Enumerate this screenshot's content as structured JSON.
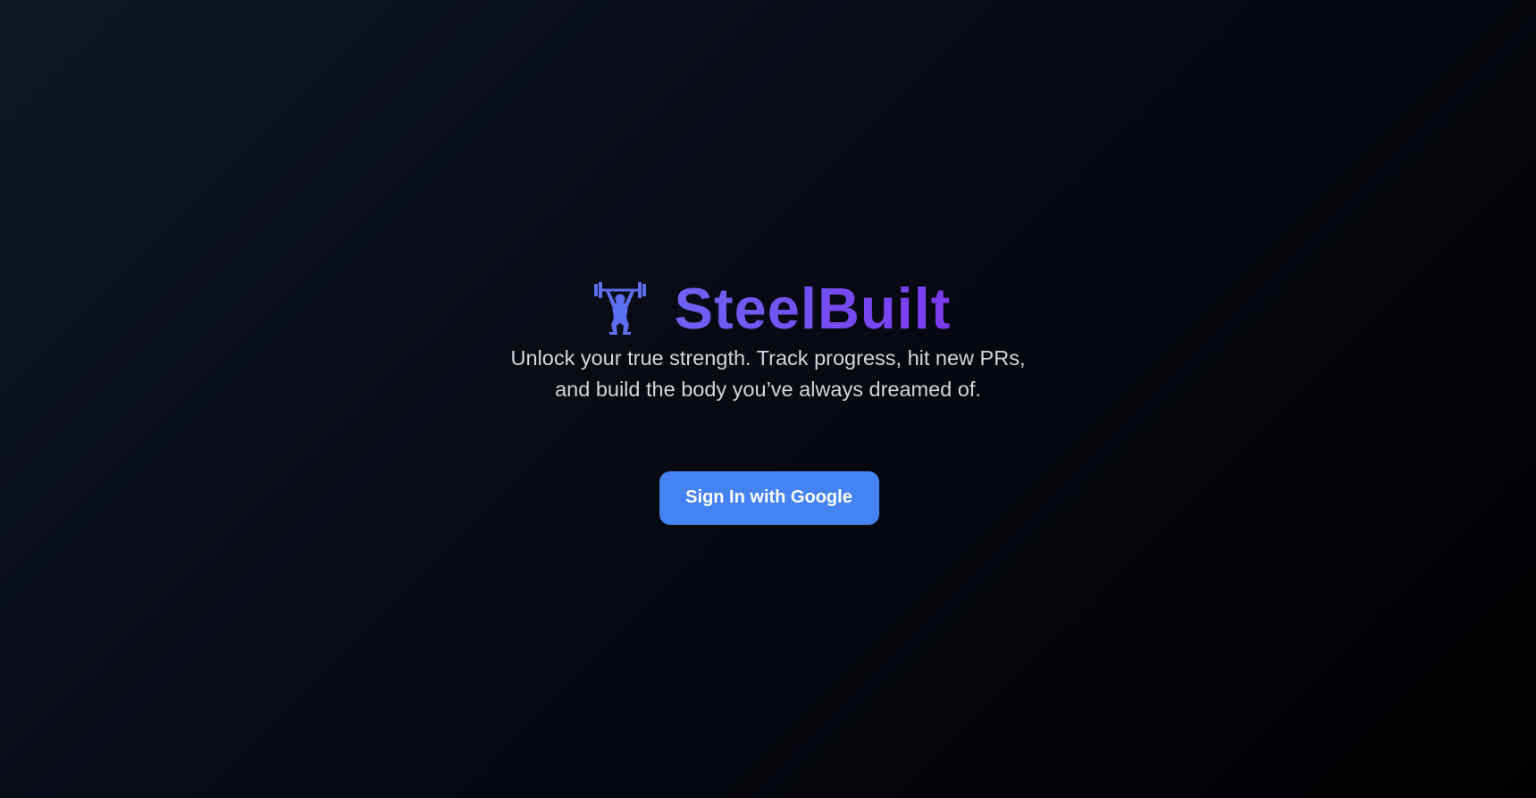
{
  "brand": {
    "icon": "weightlifter-icon",
    "name": "SteelBuilt",
    "gradient_colors": [
      "#6d63f5",
      "#7c3aed"
    ]
  },
  "tagline": "Unlock your true strength. Track progress, hit new PRs, and build the body you’ve always dreamed of.",
  "auth": {
    "signin_label": "Sign In with Google",
    "button_color": "#4483f4"
  },
  "theme": {
    "background": "#05070e",
    "text": "#d4d6de"
  }
}
